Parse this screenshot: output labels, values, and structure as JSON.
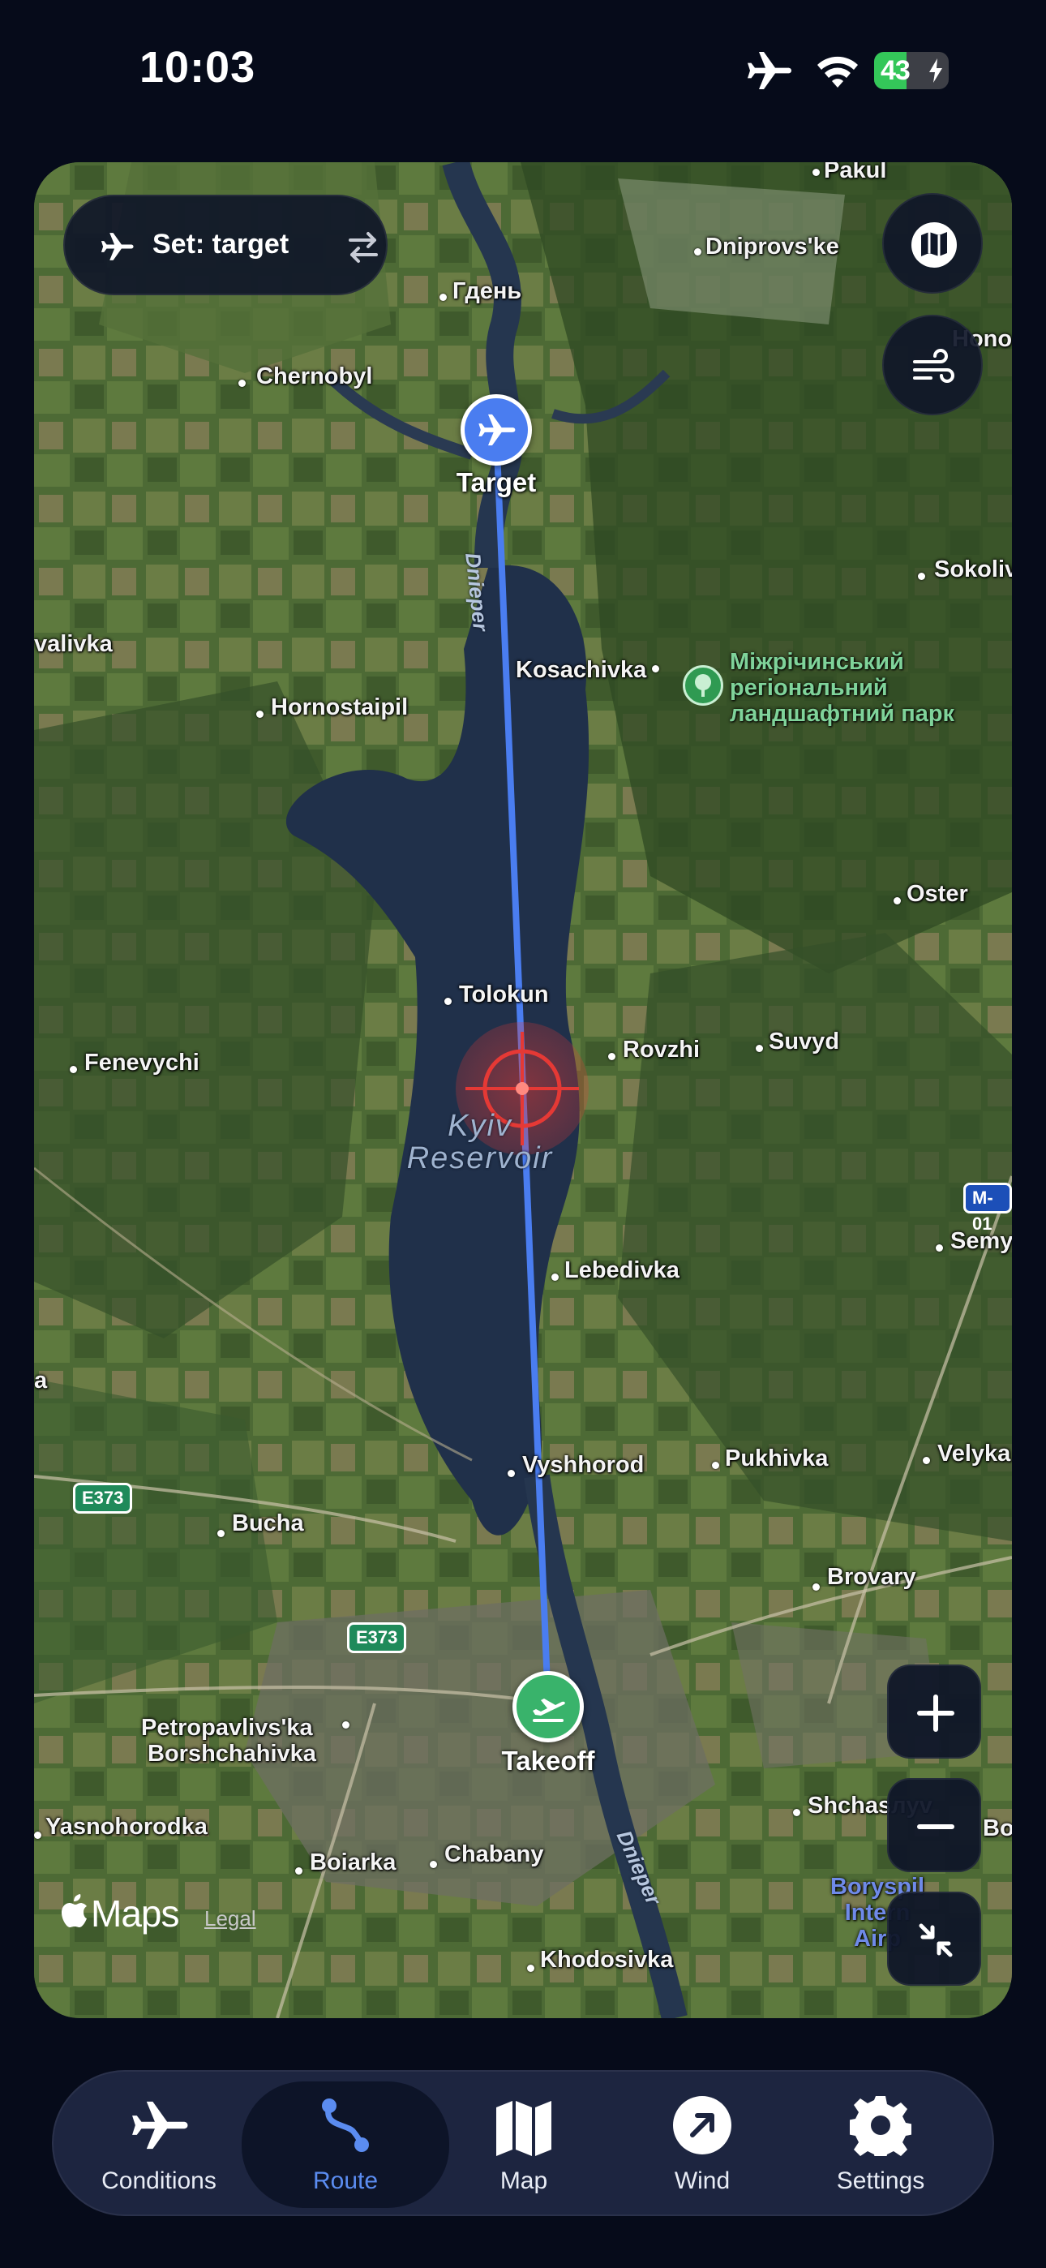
{
  "status_bar": {
    "time": "10:03",
    "battery_percent": "43",
    "icons": [
      "airplane-mode-icon",
      "wifi-icon",
      "battery-charging-icon"
    ]
  },
  "map": {
    "set_target_label": "Set: target",
    "places": [
      {
        "id": "pakul",
        "name": "Pakul"
      },
      {
        "id": "dniprovske",
        "name": "Dniprovs'ke"
      },
      {
        "id": "gden",
        "name": "Гдень"
      },
      {
        "id": "chornobyl",
        "name": "Chernobyl"
      },
      {
        "id": "hono",
        "name": "Hono"
      },
      {
        "id": "sokoliv",
        "name": "Sokoliv"
      },
      {
        "id": "valivka",
        "name": "valivka"
      },
      {
        "id": "kosachivka",
        "name": "Kosachivka"
      },
      {
        "id": "hornostaipil",
        "name": "Hornostaipil"
      },
      {
        "id": "oster",
        "name": "Oster"
      },
      {
        "id": "tolokun",
        "name": "Tolokun"
      },
      {
        "id": "rovzhi",
        "name": "Rovzhi"
      },
      {
        "id": "suvyd",
        "name": "Suvyd"
      },
      {
        "id": "fenevychi",
        "name": "Fenevychi"
      },
      {
        "id": "semy",
        "name": "Semy"
      },
      {
        "id": "lebedivka",
        "name": "Lebedivka"
      },
      {
        "id": "a",
        "name": "a"
      },
      {
        "id": "vyshhorod",
        "name": "Vyshhorod"
      },
      {
        "id": "pukhivka",
        "name": "Pukhivka"
      },
      {
        "id": "velyka",
        "name": "Velyka"
      },
      {
        "id": "bucha",
        "name": "Bucha"
      },
      {
        "id": "brovary",
        "name": "Brovary"
      },
      {
        "id": "petropavlivska",
        "name": "Petropavlivs'ka"
      },
      {
        "id": "borshchahivka",
        "name": "Borshchahivka"
      },
      {
        "id": "shchastlyv",
        "name": "Shchasлyv"
      },
      {
        "id": "bo",
        "name": "Bo"
      },
      {
        "id": "yasnohorodka",
        "name": "Yasnohorodka"
      },
      {
        "id": "boiarka",
        "name": "Boiarka"
      },
      {
        "id": "chabany",
        "name": "Chabany"
      },
      {
        "id": "khodosivka",
        "name": "Khodosivka"
      }
    ],
    "park_label_lines": [
      "Міжрічинський",
      "регіональний",
      "ландшафтний парк"
    ],
    "reservoir_label_lines": [
      "Kyiv",
      "Reservoir"
    ],
    "river_label_north": "Dnieper",
    "river_label_south": "Dnieper",
    "airport_label_lines": [
      "Boryspil",
      "Intern",
      "Airp"
    ],
    "road_shields": [
      "E373",
      "E373",
      "M-01"
    ],
    "target_label": "Target",
    "takeoff_label": "Takeoff",
    "maps_brand": "Maps",
    "legal_link": "Legal"
  },
  "tabs": [
    {
      "id": "conditions",
      "label": "Conditions",
      "icon": "airplane-icon",
      "active": false
    },
    {
      "id": "route",
      "label": "Route",
      "icon": "route-icon",
      "active": true
    },
    {
      "id": "map",
      "label": "Map",
      "icon": "map-icon",
      "active": false
    },
    {
      "id": "wind",
      "label": "Wind",
      "icon": "wind-arrow-icon",
      "active": false
    },
    {
      "id": "settings",
      "label": "Settings",
      "icon": "gear-icon",
      "active": false
    }
  ],
  "colors": {
    "background": "#060b1a",
    "route_line": "#4a7df0",
    "target_marker": "#4a7df0",
    "takeoff_marker": "#39b36b",
    "crosshair": "#e53935",
    "active_tab": "#5b8cf0"
  }
}
